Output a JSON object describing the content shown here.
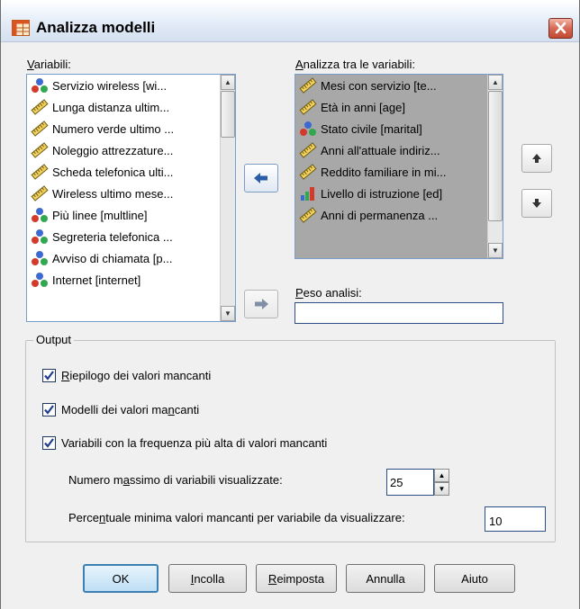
{
  "window": {
    "title": "Analizza modelli"
  },
  "source_list": {
    "label_html": "<u>V</u>ariabili:",
    "items": [
      {
        "label": "Servizio wireless [wi...",
        "icon": "nominal-icon"
      },
      {
        "label": "Lunga distanza ultim...",
        "icon": "scale-icon"
      },
      {
        "label": "Numero verde ultimo ...",
        "icon": "scale-icon"
      },
      {
        "label": "Noleggio attrezzature...",
        "icon": "scale-icon"
      },
      {
        "label": "Scheda telefonica ulti...",
        "icon": "scale-icon"
      },
      {
        "label": "Wireless ultimo mese...",
        "icon": "scale-icon"
      },
      {
        "label": "Più linee [multline]",
        "icon": "nominal-icon"
      },
      {
        "label": "Segreteria telefonica ...",
        "icon": "nominal-icon"
      },
      {
        "label": "Avviso di chiamata [p...",
        "icon": "nominal-icon"
      },
      {
        "label": "Internet [internet]",
        "icon": "nominal-icon"
      }
    ]
  },
  "target_list": {
    "label_html": "<u>A</u>nalizza tra le variabili:",
    "items": [
      {
        "label": "Mesi con servizio [te...",
        "icon": "scale-icon"
      },
      {
        "label": "Età in anni [age]",
        "icon": "scale-icon"
      },
      {
        "label": "Stato civile [marital]",
        "icon": "nominal-icon"
      },
      {
        "label": "Anni all'attuale indiriz...",
        "icon": "scale-icon"
      },
      {
        "label": "Reddito familiare in mi...",
        "icon": "scale-icon"
      },
      {
        "label": "Livello di istruzione [ed]",
        "icon": "ordinal-icon"
      },
      {
        "label": "Anni di permanenza ...",
        "icon": "scale-icon"
      }
    ]
  },
  "weight": {
    "label_html": "<u>P</u>eso analisi:",
    "value": ""
  },
  "output": {
    "title": "Output",
    "missing_summary": {
      "label_html": "<u>R</u>iepilogo dei valori mancanti",
      "checked": true
    },
    "missing_patterns": {
      "label_html": "Modelli dei valori ma<u>n</u>canti",
      "checked": true
    },
    "highest_freq": {
      "label_html": "Variabili con la frequenza più alta di valori mancanti",
      "checked": true
    },
    "max_vars_label_html": "Numero m<u>a</u>ssimo di variabili visualizzate:",
    "max_vars_value": "25",
    "min_pct_label_html": "Perce<u>n</u>tuale minima valori mancanti per variabile da visualizzare:",
    "min_pct_value": "10"
  },
  "buttons": {
    "ok": "OK",
    "paste_html": "<u>I</u>ncolla",
    "reset_html": "<u>R</u>eimposta",
    "cancel": "Annulla",
    "help": "Aiuto"
  }
}
